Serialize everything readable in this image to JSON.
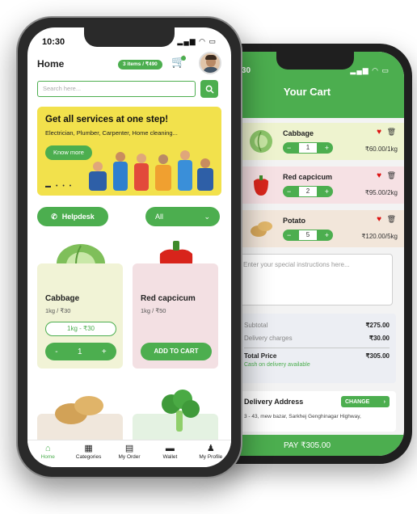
{
  "front": {
    "time": "10:30",
    "status_icons": "▂▄▆ ◠ ▭",
    "home_title": "Home",
    "cart_summary": "3 items / ₹490",
    "search_placeholder": "Search here...",
    "banner": {
      "title": "Get all services at one step!",
      "subtitle": "Electrician, Plumber, Carpenter, Home cleaning...",
      "button": "Know more",
      "dots": "▬ • • •"
    },
    "helpdesk_label": "Helpdesk",
    "filter_value": "All",
    "products": [
      {
        "name": "Cabbage",
        "unit": "1kg / ₹30",
        "selected": "1kg - ₹30",
        "qty": "1",
        "minus": "-",
        "plus": "+"
      },
      {
        "name": "Red capcicum",
        "unit": "1kg / ₹50",
        "action": "ADD TO CART"
      }
    ],
    "nav": [
      {
        "label": "Home",
        "icon": "⌂"
      },
      {
        "label": "Categories",
        "icon": "▦"
      },
      {
        "label": "My Order",
        "icon": "▤"
      },
      {
        "label": "Wallet",
        "icon": "▬"
      },
      {
        "label": "My Profile",
        "icon": "♟"
      }
    ]
  },
  "back": {
    "time": "4:30",
    "status_icons": "▂▄▆ ◠ ▭",
    "title": "Your Cart",
    "items": [
      {
        "name": "Cabbage",
        "qty": "1",
        "price": "₹60.00/1kg",
        "minus": "−",
        "plus": "+"
      },
      {
        "name": "Red capcicum",
        "qty": "2",
        "price": "₹95.00/2kg",
        "minus": "−",
        "plus": "+"
      },
      {
        "name": "Potato",
        "qty": "5",
        "price": "₹120.00/5kg",
        "minus": "−",
        "plus": "+"
      }
    ],
    "instructions_placeholder": "Enter your special instructions here...",
    "summary": {
      "subtotal_label": "Subtotal",
      "subtotal": "₹275.00",
      "delivery_label": "Delivery charges",
      "delivery": "₹30.00",
      "total_label": "Total Price",
      "total": "₹305.00",
      "cod": "Cash on delivery available"
    },
    "address": {
      "title": "Delivery Address",
      "change": "CHANGE",
      "text": "3 - 43, mew bazar, Sarkhej Genghinagar Highway,"
    },
    "pay": "PAY  ₹305.00"
  },
  "colors": {
    "accent": "#4cae4f",
    "banner": "#f2e14c"
  }
}
